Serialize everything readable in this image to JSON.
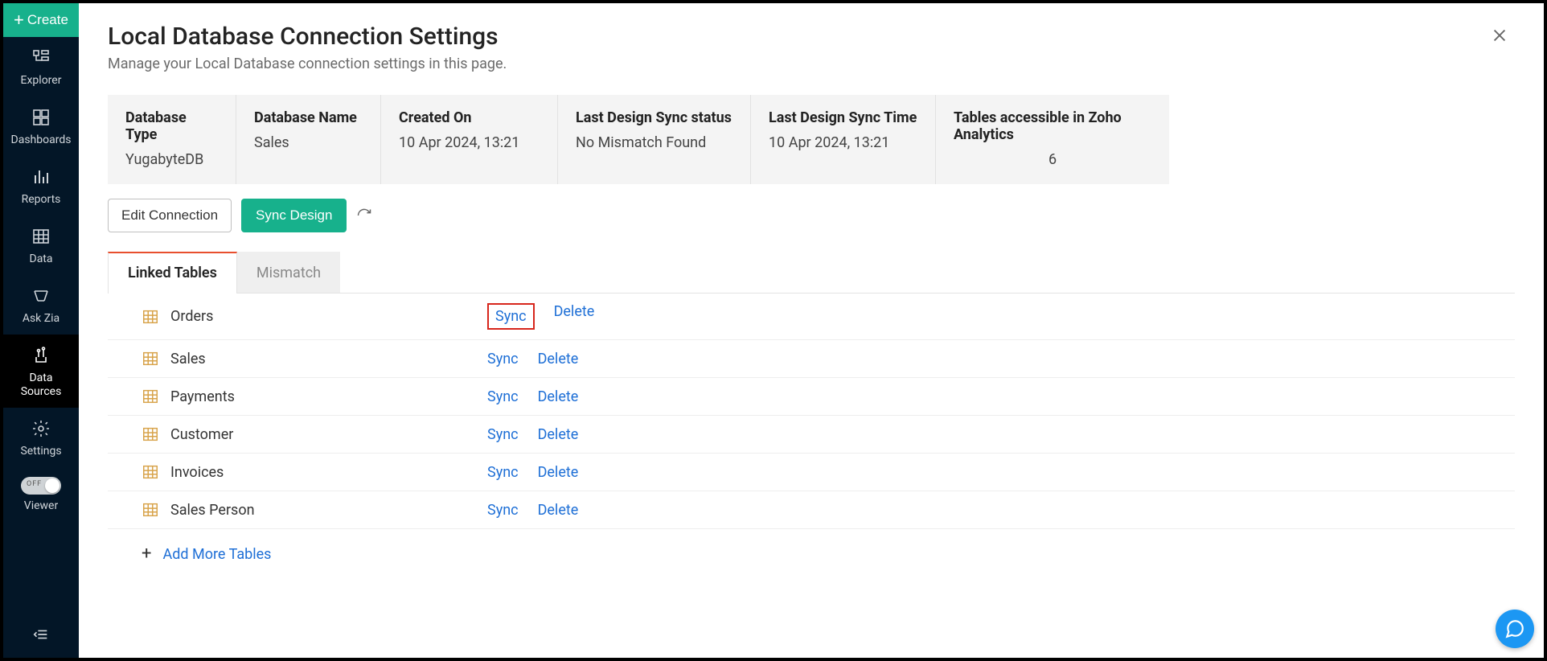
{
  "sidebar": {
    "create_label": "Create",
    "items": [
      {
        "label": "Explorer"
      },
      {
        "label": "Dashboards"
      },
      {
        "label": "Reports"
      },
      {
        "label": "Data"
      },
      {
        "label": "Ask Zia"
      },
      {
        "label": "Data\nSources"
      },
      {
        "label": "Settings"
      }
    ],
    "toggle_off_label": "OFF",
    "viewer_label": "Viewer"
  },
  "header": {
    "title": "Local Database Connection Settings",
    "subtitle": "Manage your Local Database connection settings in this page."
  },
  "info": {
    "db_type_label": "Database Type",
    "db_type_value": "YugabyteDB",
    "db_name_label": "Database Name",
    "db_name_value": "Sales",
    "created_on_label": "Created On",
    "created_on_value": "10 Apr 2024, 13:21",
    "last_status_label": "Last Design Sync status",
    "last_status_value": "No Mismatch Found",
    "last_time_label": "Last Design Sync Time",
    "last_time_value": "10 Apr 2024, 13:21",
    "tables_count_label": "Tables accessible in Zoho Analytics",
    "tables_count_value": "6"
  },
  "actions": {
    "edit_connection": "Edit Connection",
    "sync_design": "Sync Design"
  },
  "tabs": {
    "linked": "Linked Tables",
    "mismatch": "Mismatch"
  },
  "tables": [
    {
      "name": "Orders",
      "highlight_sync": true
    },
    {
      "name": "Sales",
      "highlight_sync": false
    },
    {
      "name": "Payments",
      "highlight_sync": false
    },
    {
      "name": "Customer",
      "highlight_sync": false
    },
    {
      "name": "Invoices",
      "highlight_sync": false
    },
    {
      "name": "Sales Person",
      "highlight_sync": false
    }
  ],
  "row_actions": {
    "sync": "Sync",
    "delete": "Delete"
  },
  "add_more": "Add More Tables"
}
